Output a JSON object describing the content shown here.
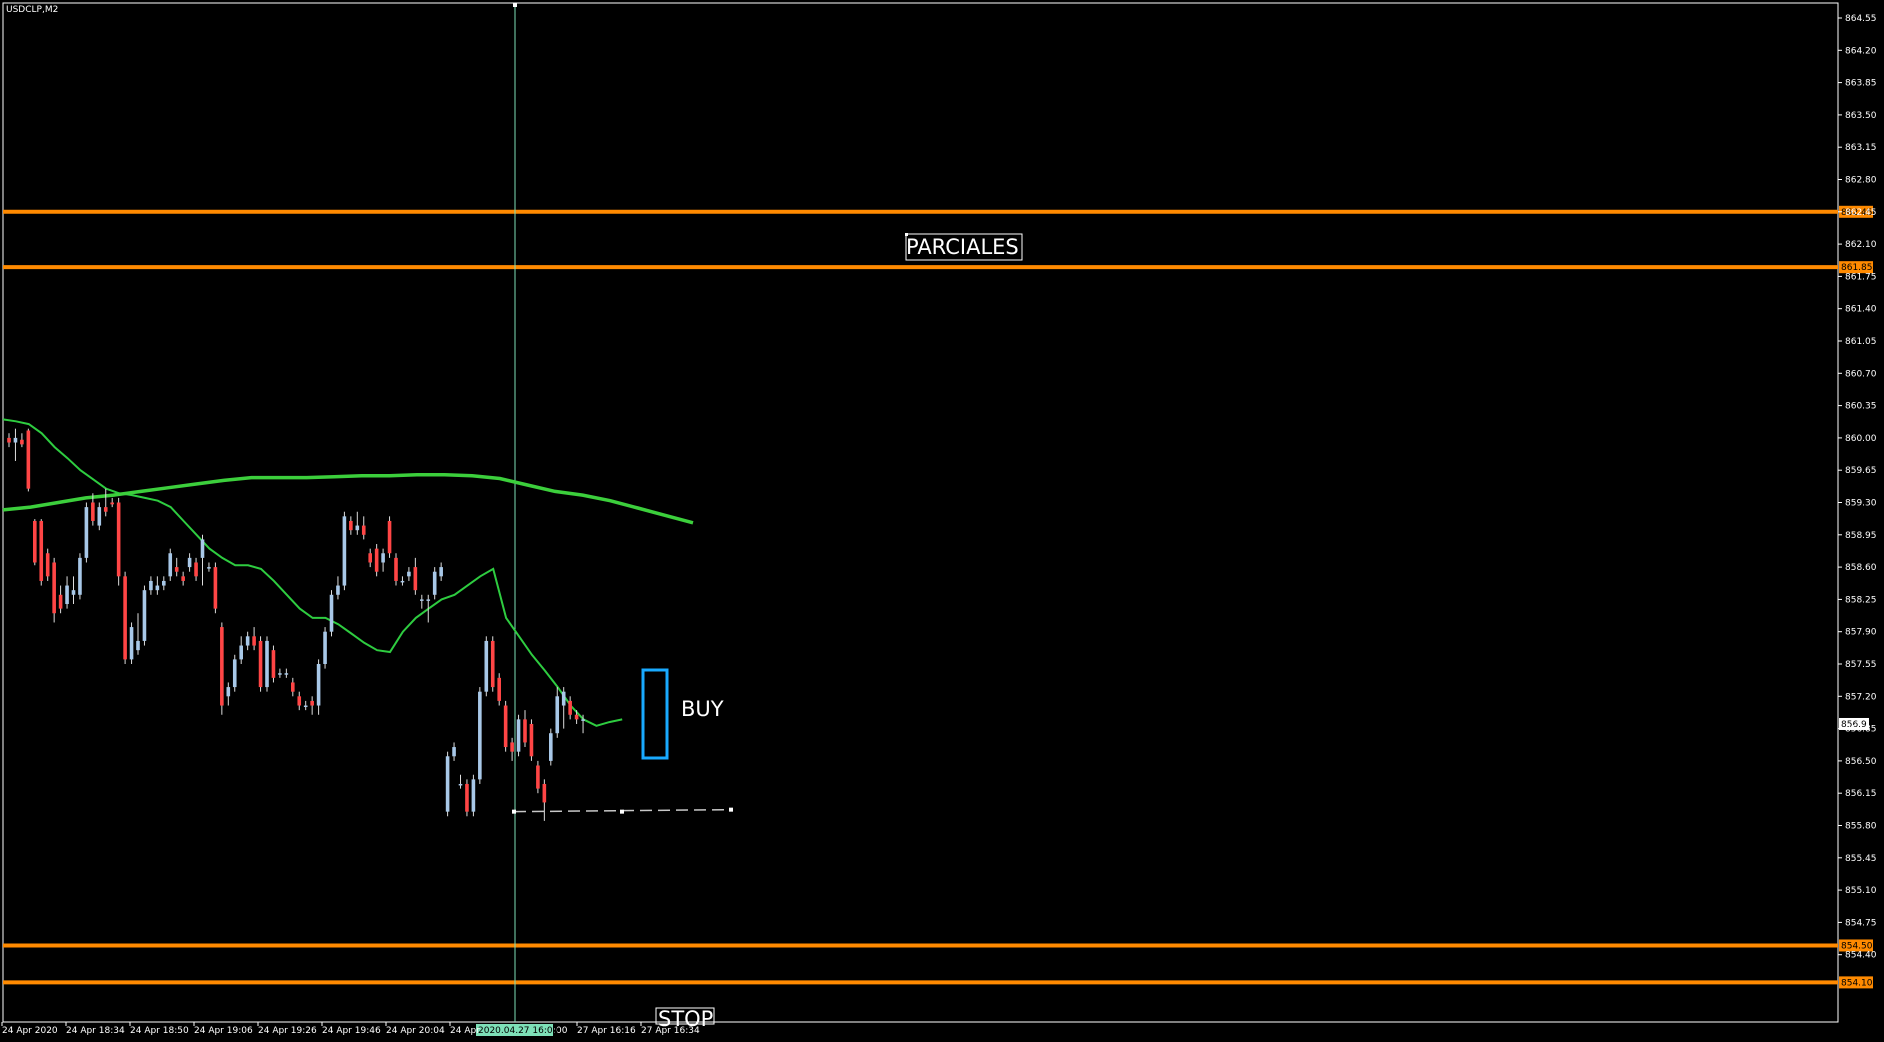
{
  "symbol_label": "USDCLP,M2",
  "colors": {
    "background": "#000000",
    "frame": "#ffffff",
    "bull_candle": "#a8c8e8",
    "bear_candle": "#ff4545",
    "ma_fast": "#2ecc40",
    "ma_slow": "#3ccf3c",
    "hline": "#ff8a00",
    "vline": "#7ee0b8",
    "highlight_box": "#19aaff",
    "dashed_line": "#c8c8c8"
  },
  "chart_data": {
    "type": "candlestick",
    "y_range": [
      854.1,
      864.7
    ],
    "y_ticks": [
      "864.55",
      "864.20",
      "863.85",
      "863.50",
      "863.15",
      "862.80",
      "862.45",
      "862.10",
      "861.75",
      "861.40",
      "861.05",
      "860.70",
      "860.35",
      "860.00",
      "859.65",
      "859.30",
      "858.95",
      "858.60",
      "858.25",
      "857.90",
      "857.55",
      "857.20",
      "856.85",
      "856.50",
      "856.15",
      "855.80",
      "855.45",
      "855.10",
      "854.75",
      "854.40"
    ],
    "x_tick_labels": [
      "24 Apr 2020",
      "24 Apr 18:34",
      "24 Apr 18:50",
      "24 Apr 19:06",
      "24 Apr 19:26",
      "24 Apr 19:46",
      "24 Apr 20:04",
      "24 Apr",
      "27 Apr 16:16",
      "27 Apr 16:34"
    ],
    "x_ticks_after_vline": [
      ":00"
    ],
    "vertical_line_label": "2020.04.27 16:00",
    "candles": [
      {
        "o": 860.0,
        "h": 860.05,
        "l": 859.9,
        "c": 859.95
      },
      {
        "o": 859.95,
        "h": 860.1,
        "l": 859.75,
        "c": 860.0
      },
      {
        "o": 859.98,
        "h": 860.05,
        "l": 859.9,
        "c": 859.93
      },
      {
        "o": 860.08,
        "h": 860.1,
        "l": 859.42,
        "c": 859.45
      },
      {
        "o": 859.1,
        "h": 859.12,
        "l": 858.62,
        "c": 858.65
      },
      {
        "o": 859.1,
        "h": 859.12,
        "l": 858.4,
        "c": 858.45
      },
      {
        "o": 858.75,
        "h": 858.8,
        "l": 858.45,
        "c": 858.5
      },
      {
        "o": 858.65,
        "h": 858.7,
        "l": 858.0,
        "c": 858.1
      },
      {
        "o": 858.3,
        "h": 858.4,
        "l": 858.1,
        "c": 858.15
      },
      {
        "o": 858.2,
        "h": 858.5,
        "l": 858.15,
        "c": 858.4
      },
      {
        "o": 858.3,
        "h": 858.5,
        "l": 858.2,
        "c": 858.35
      },
      {
        "o": 858.3,
        "h": 858.75,
        "l": 858.25,
        "c": 858.7
      },
      {
        "o": 858.7,
        "h": 859.3,
        "l": 858.65,
        "c": 859.25
      },
      {
        "o": 859.3,
        "h": 859.4,
        "l": 859.05,
        "c": 859.1
      },
      {
        "o": 859.05,
        "h": 859.3,
        "l": 859.0,
        "c": 859.25
      },
      {
        "o": 859.25,
        "h": 859.45,
        "l": 859.15,
        "c": 859.2
      },
      {
        "o": 859.3,
        "h": 859.35,
        "l": 859.25,
        "c": 859.28
      },
      {
        "o": 859.3,
        "h": 859.35,
        "l": 858.4,
        "c": 858.5
      },
      {
        "o": 858.5,
        "h": 858.55,
        "l": 857.55,
        "c": 857.6
      },
      {
        "o": 857.6,
        "h": 858.0,
        "l": 857.55,
        "c": 857.95
      },
      {
        "o": 857.7,
        "h": 858.1,
        "l": 857.65,
        "c": 857.8
      },
      {
        "o": 857.8,
        "h": 858.4,
        "l": 857.75,
        "c": 858.35
      },
      {
        "o": 858.35,
        "h": 858.5,
        "l": 858.3,
        "c": 858.45
      },
      {
        "o": 858.35,
        "h": 858.5,
        "l": 858.3,
        "c": 858.4
      },
      {
        "o": 858.4,
        "h": 858.5,
        "l": 858.35,
        "c": 858.45
      },
      {
        "o": 858.5,
        "h": 858.8,
        "l": 858.45,
        "c": 858.75
      },
      {
        "o": 858.6,
        "h": 858.7,
        "l": 858.5,
        "c": 858.55
      },
      {
        "o": 858.5,
        "h": 858.55,
        "l": 858.4,
        "c": 858.45
      },
      {
        "o": 858.6,
        "h": 858.75,
        "l": 858.55,
        "c": 858.7
      },
      {
        "o": 858.65,
        "h": 858.7,
        "l": 858.45,
        "c": 858.5
      },
      {
        "o": 858.7,
        "h": 858.95,
        "l": 858.4,
        "c": 858.9
      },
      {
        "o": 858.6,
        "h": 858.65,
        "l": 858.55,
        "c": 858.6
      },
      {
        "o": 858.6,
        "h": 858.65,
        "l": 858.1,
        "c": 858.15
      },
      {
        "o": 857.95,
        "h": 858.0,
        "l": 857.0,
        "c": 857.1
      },
      {
        "o": 857.2,
        "h": 857.35,
        "l": 857.1,
        "c": 857.3
      },
      {
        "o": 857.3,
        "h": 857.65,
        "l": 857.25,
        "c": 857.6
      },
      {
        "o": 857.6,
        "h": 857.85,
        "l": 857.55,
        "c": 857.75
      },
      {
        "o": 857.75,
        "h": 857.9,
        "l": 857.7,
        "c": 857.85
      },
      {
        "o": 857.85,
        "h": 857.95,
        "l": 857.7,
        "c": 857.75
      },
      {
        "o": 857.8,
        "h": 857.85,
        "l": 857.25,
        "c": 857.3
      },
      {
        "o": 857.3,
        "h": 857.85,
        "l": 857.25,
        "c": 857.8
      },
      {
        "o": 857.7,
        "h": 857.75,
        "l": 857.35,
        "c": 857.4
      },
      {
        "o": 857.45,
        "h": 857.5,
        "l": 857.4,
        "c": 857.45
      },
      {
        "o": 857.45,
        "h": 857.5,
        "l": 857.4,
        "c": 857.45
      },
      {
        "o": 857.35,
        "h": 857.4,
        "l": 857.2,
        "c": 857.25
      },
      {
        "o": 857.2,
        "h": 857.25,
        "l": 857.05,
        "c": 857.1
      },
      {
        "o": 857.1,
        "h": 857.15,
        "l": 857.05,
        "c": 857.1
      },
      {
        "o": 857.15,
        "h": 857.2,
        "l": 857.0,
        "c": 857.1
      },
      {
        "o": 857.1,
        "h": 857.6,
        "l": 857.0,
        "c": 857.55
      },
      {
        "o": 857.55,
        "h": 857.95,
        "l": 857.5,
        "c": 857.9
      },
      {
        "o": 857.9,
        "h": 858.35,
        "l": 857.85,
        "c": 858.3
      },
      {
        "o": 858.3,
        "h": 858.5,
        "l": 858.25,
        "c": 858.4
      },
      {
        "o": 858.4,
        "h": 859.2,
        "l": 858.35,
        "c": 859.15
      },
      {
        "o": 859.1,
        "h": 859.15,
        "l": 858.95,
        "c": 859.0
      },
      {
        "o": 859.0,
        "h": 859.2,
        "l": 858.95,
        "c": 859.05
      },
      {
        "o": 859.05,
        "h": 859.15,
        "l": 858.9,
        "c": 858.95
      },
      {
        "o": 858.75,
        "h": 858.8,
        "l": 858.6,
        "c": 858.65
      },
      {
        "o": 858.8,
        "h": 858.85,
        "l": 858.5,
        "c": 858.55
      },
      {
        "o": 858.65,
        "h": 858.8,
        "l": 858.55,
        "c": 858.75
      },
      {
        "o": 859.1,
        "h": 859.15,
        "l": 858.7,
        "c": 858.75
      },
      {
        "o": 858.7,
        "h": 858.75,
        "l": 858.4,
        "c": 858.45
      },
      {
        "o": 858.45,
        "h": 858.5,
        "l": 858.4,
        "c": 858.45
      },
      {
        "o": 858.5,
        "h": 858.6,
        "l": 858.45,
        "c": 858.55
      },
      {
        "o": 858.6,
        "h": 858.7,
        "l": 858.3,
        "c": 858.35
      },
      {
        "o": 858.25,
        "h": 858.3,
        "l": 858.15,
        "c": 858.25
      },
      {
        "o": 858.25,
        "h": 858.3,
        "l": 858.0,
        "c": 858.25
      },
      {
        "o": 858.3,
        "h": 858.6,
        "l": 858.25,
        "c": 858.55
      },
      {
        "o": 858.5,
        "h": 858.65,
        "l": 858.45,
        "c": 858.6
      },
      {
        "o": 855.95,
        "h": 856.6,
        "l": 855.9,
        "c": 856.55
      },
      {
        "o": 856.55,
        "h": 856.7,
        "l": 856.5,
        "c": 856.65
      },
      {
        "o": 856.25,
        "h": 856.35,
        "l": 856.2,
        "c": 856.25
      },
      {
        "o": 856.25,
        "h": 856.3,
        "l": 855.9,
        "c": 855.95
      },
      {
        "o": 855.95,
        "h": 856.35,
        "l": 855.9,
        "c": 856.3
      },
      {
        "o": 856.3,
        "h": 857.3,
        "l": 856.25,
        "c": 857.25
      },
      {
        "o": 857.25,
        "h": 857.85,
        "l": 857.2,
        "c": 857.8
      },
      {
        "o": 857.8,
        "h": 857.85,
        "l": 857.25,
        "c": 857.3
      },
      {
        "o": 857.4,
        "h": 857.45,
        "l": 857.1,
        "c": 857.15
      },
      {
        "o": 857.1,
        "h": 857.15,
        "l": 856.6,
        "c": 856.65
      },
      {
        "o": 856.7,
        "h": 856.75,
        "l": 856.5,
        "c": 856.6
      },
      {
        "o": 856.6,
        "h": 857.0,
        "l": 856.55,
        "c": 856.95
      },
      {
        "o": 856.95,
        "h": 857.05,
        "l": 856.65,
        "c": 856.7
      },
      {
        "o": 856.9,
        "h": 856.95,
        "l": 856.5,
        "c": 856.55
      },
      {
        "o": 856.45,
        "h": 856.5,
        "l": 856.15,
        "c": 856.2
      },
      {
        "o": 856.25,
        "h": 856.3,
        "l": 855.85,
        "c": 856.05
      },
      {
        "o": 856.5,
        "h": 856.85,
        "l": 856.45,
        "c": 856.8
      },
      {
        "o": 856.8,
        "h": 857.3,
        "l": 856.75,
        "c": 857.2
      },
      {
        "o": 857.1,
        "h": 857.3,
        "l": 856.85,
        "c": 857.25
      },
      {
        "o": 857.15,
        "h": 857.2,
        "l": 856.95,
        "c": 857.0
      },
      {
        "o": 857.0,
        "h": 857.05,
        "l": 856.9,
        "c": 856.95
      },
      {
        "o": 856.95,
        "h": 857.0,
        "l": 856.8,
        "c": 856.95
      }
    ],
    "ma_fast": [
      860.2,
      860.18,
      860.15,
      860.05,
      859.9,
      859.78,
      859.65,
      859.55,
      859.45,
      859.4,
      859.38,
      859.35,
      859.32,
      859.25,
      859.1,
      858.95,
      858.8,
      858.7,
      858.62,
      858.62,
      858.58,
      858.45,
      858.3,
      858.15,
      858.05,
      858.05,
      857.98,
      857.88,
      857.78,
      857.7,
      857.68,
      857.9,
      858.05,
      858.15,
      858.25,
      858.3,
      858.4,
      858.5,
      858.58,
      858.05,
      857.85,
      857.65,
      857.48,
      857.3,
      857.1,
      856.95,
      856.88,
      856.92,
      856.95
    ],
    "ma_slow": [
      859.22,
      859.25,
      859.3,
      859.35,
      859.38,
      859.42,
      859.46,
      859.5,
      859.54,
      859.57,
      859.57,
      859.57,
      859.58,
      859.59,
      859.59,
      859.6,
      859.6,
      859.59,
      859.56,
      859.49,
      859.42,
      859.38,
      859.32,
      859.24,
      859.16,
      859.08
    ],
    "horizontal_levels": [
      {
        "price": 862.45,
        "label": "862.45"
      },
      {
        "price": 861.85,
        "label": "861.85"
      },
      {
        "price": 854.5,
        "label": "854.50"
      },
      {
        "price": 854.1,
        "label": "854.10"
      }
    ],
    "current_price_label": "856.9",
    "dashed_level": 855.95,
    "annotations": {
      "parciales": "PARCIALES",
      "buy": "BUY",
      "stop": "STOP"
    }
  }
}
